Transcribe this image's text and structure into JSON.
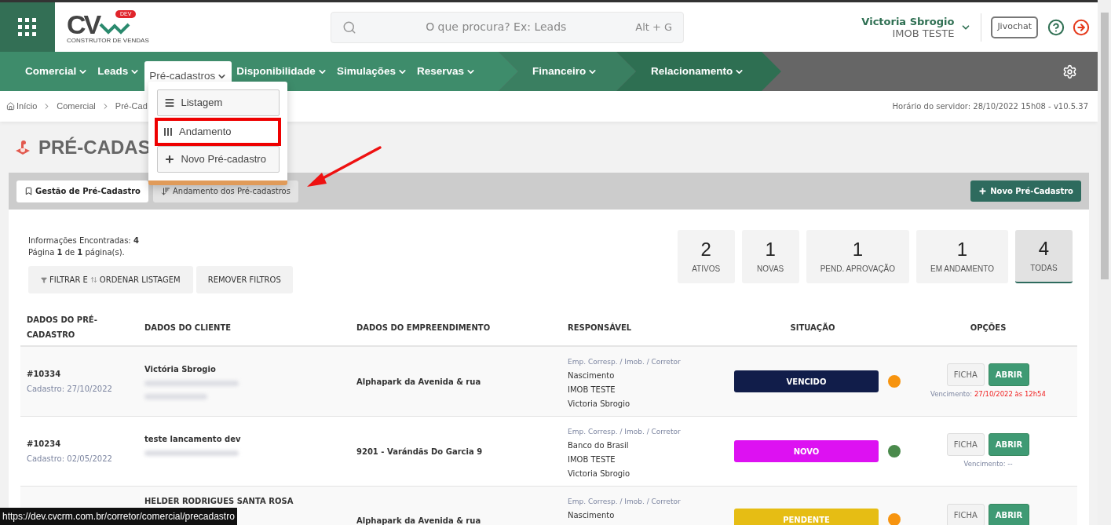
{
  "header": {
    "logo": {
      "mark": "CV",
      "badge": "DEV",
      "tagline": "CONSTRUTOR DE VENDAS"
    },
    "search": {
      "placeholder": "O que procura? Ex: Leads",
      "shortcut": "Alt + G"
    },
    "user": {
      "name": "Victoria Sbrogio",
      "company": "IMOB TESTE"
    },
    "chat_button": "Jivochat"
  },
  "nav": {
    "segments": [
      {
        "items": [
          {
            "label": "Comercial",
            "selected": false
          },
          {
            "label": "Leads",
            "selected": false
          },
          {
            "label": "Pré-cadastros",
            "selected": true
          },
          {
            "label": "Disponibilidade",
            "selected": false
          },
          {
            "label": "Simulações",
            "selected": false
          },
          {
            "label": "Reservas",
            "selected": false
          }
        ]
      },
      {
        "items": [
          {
            "label": "Financeiro",
            "selected": false
          }
        ]
      },
      {
        "items": [
          {
            "label": "Relacionamento",
            "selected": false
          }
        ]
      }
    ]
  },
  "dropdown": [
    {
      "kind": "list",
      "label": "Listagem",
      "annotated": false
    },
    {
      "kind": "columns",
      "label": "Andamento",
      "annotated": true
    },
    {
      "kind": "plus",
      "label": "Novo Pré-cadastro",
      "annotated": false
    }
  ],
  "breadcrumb": [
    "Início",
    "Comercial",
    "Pré-Cad"
  ],
  "server_time": "Horário do servidor: 28/10/2022 15h08 - v10.5.37",
  "page_title": "PRÉ-CADAS",
  "tabs": [
    {
      "kind": "bookmark",
      "label": "Gestão de Pré-Cadastro",
      "selected": true
    },
    {
      "kind": "sort",
      "label": "Andamento dos Pré-cadastros",
      "selected": false
    }
  ],
  "new_button": "Novo Pré-Cadastro",
  "info": [
    "Informações Encontradas: **4**",
    "Página **1** de **1** página(s)."
  ],
  "filter_button": {
    "label_1": "FILTRAR E",
    "label_2": "ORDENAR LISTAGEM"
  },
  "remove_filters_button": "REMOVER FILTROS",
  "stats": [
    {
      "value": "2",
      "label": "ATIVOS",
      "selected": false
    },
    {
      "value": "1",
      "label": "NOVAS",
      "selected": false
    },
    {
      "value": "1",
      "label": "PEND. APROVAÇÃO",
      "selected": false
    },
    {
      "value": "1",
      "label": "EM ANDAMENTO",
      "selected": false
    },
    {
      "value": "4",
      "label": "TODAS",
      "selected": true
    }
  ],
  "table": {
    "columns": [
      "DADOS DO PRÉ-CADASTRO",
      "DADOS DO CLIENTE",
      "DADOS DO EMPREENDIMENTO",
      "RESPONSÁVEL",
      "SITUAÇÃO",
      "OPÇÕES"
    ],
    "rows": [
      {
        "id": "#10334",
        "registered": "Cadastro: 27/10/2022",
        "client": "Victória Sbrogio",
        "blurred_lines": [
          {
            "kind": "long"
          },
          {
            "kind": "short"
          }
        ],
        "project": "Alphapark da Avenida & rua",
        "role_label": "Emp. Corresp. / Imob. / Corretor",
        "responsible": [
          "Nascimento",
          "IMOB TESTE",
          "Victoria Sbrogio"
        ],
        "status": {
          "label": "VENCIDO",
          "color": "#111d4a"
        },
        "dot": {
          "color": "#f7940f"
        },
        "actions": [
          "FICHA",
          "ABRIR"
        ],
        "due_label": "Vencimento:",
        "due_value": "27/10/2022 às 12h54",
        "overdue": true
      },
      {
        "id": "#10234",
        "registered": "Cadastro: 02/05/2022",
        "client": "teste lancamento dev",
        "blurred_lines": [
          {
            "kind": "long"
          }
        ],
        "project": "9201 - Varándãs Do Garcia 9",
        "role_label": "Emp. Corresp. / Imob. / Corretor",
        "responsible": [
          "Banco do Brasil",
          "IMOB TESTE",
          "Victoria Sbrogio"
        ],
        "status": {
          "label": "NOVO",
          "color": "#dd11f2"
        },
        "dot": {
          "color": "#4a8a4c"
        },
        "actions": [
          "FICHA",
          "ABRIR"
        ],
        "due_label": "Vencimento:",
        "due_value": "--",
        "overdue": false
      },
      {
        "client": "HELDER RODRIGUES SANTA ROSA",
        "project": "Alphapark da Avenida & rua",
        "role_label": "Emp. Corresp. / Imob. / Corretor",
        "responsible": [
          "Nascimento"
        ],
        "status": {
          "label": "PENDENTE",
          "color": "#e6bd14"
        },
        "dot": {
          "color": "#f7940f"
        },
        "actions": [
          "FICHA",
          "ABRIR"
        ]
      }
    ]
  },
  "link_preview": "https://dev.cvcrm.com.br/corretor/comercial/precadastro"
}
